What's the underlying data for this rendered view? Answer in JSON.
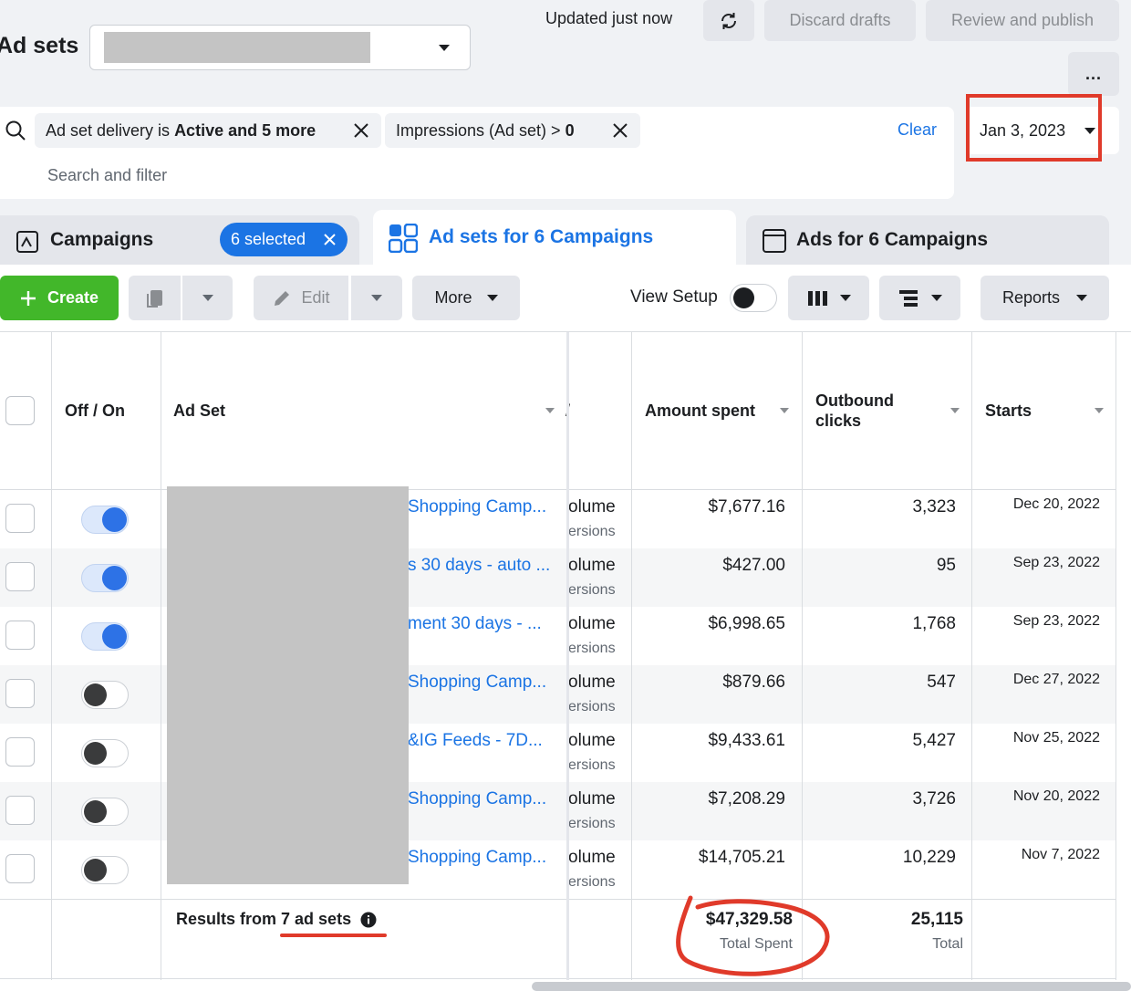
{
  "header": {
    "title": "Ad sets",
    "updated_text": "Updated just now",
    "discard_label": "Discard drafts",
    "review_label": "Review and publish",
    "more_label": "..."
  },
  "filters": {
    "chip1_prefix": "Ad set delivery is ",
    "chip1_bold": "Active and 5 more",
    "chip2_prefix": "Impressions (Ad set) > ",
    "chip2_bold": "0",
    "clear_label": "Clear",
    "search_placeholder": "Search and filter",
    "date": "Jan 3, 2023"
  },
  "tabs": {
    "campaigns": "Campaigns",
    "selected": "6 selected",
    "adsets": "Ad sets for 6 Campaigns",
    "ads": "Ads for 6 Campaigns"
  },
  "toolbar": {
    "create_label": "Create",
    "edit_label": "Edit",
    "more_label": "More",
    "view_setup_label": "View Setup",
    "reports_label": "Reports"
  },
  "table": {
    "headers": {
      "offon": "Off / On",
      "adset": "Ad Set",
      "amount": "Amount spent",
      "clicks_line1": "Outbound",
      "clicks_line2": "clicks",
      "starts": "Starts"
    },
    "rows": [
      {
        "name": "Shopping Camp...",
        "vol": "olume",
        "sub": "ersions",
        "amount": "$7,677.16",
        "clicks": "3,323",
        "start": "Dec 20, 2022",
        "on": true
      },
      {
        "name": "s 30 days - auto ...",
        "vol": "olume",
        "sub": "ersions",
        "amount": "$427.00",
        "clicks": "95",
        "start": "Sep 23, 2022",
        "on": true
      },
      {
        "name": "ment 30 days - ...",
        "vol": "olume",
        "sub": "ersions",
        "amount": "$6,998.65",
        "clicks": "1,768",
        "start": "Sep 23, 2022",
        "on": true
      },
      {
        "name": "Shopping Camp...",
        "vol": "olume",
        "sub": "ersions",
        "amount": "$879.66",
        "clicks": "547",
        "start": "Dec 27, 2022",
        "on": false
      },
      {
        "name": "&IG Feeds - 7D...",
        "vol": "olume",
        "sub": "ersions",
        "amount": "$9,433.61",
        "clicks": "5,427",
        "start": "Nov 25, 2022",
        "on": false
      },
      {
        "name": "Shopping Camp...",
        "vol": "olume",
        "sub": "ersions",
        "amount": "$7,208.29",
        "clicks": "3,726",
        "start": "Nov 20, 2022",
        "on": false
      },
      {
        "name": "Shopping Camp...",
        "vol": "olume",
        "sub": "ersions",
        "amount": "$14,705.21",
        "clicks": "10,229",
        "start": "Nov 7, 2022",
        "on": false
      }
    ],
    "footer": {
      "results_prefix": "Results from ",
      "results_count": "7 ad sets",
      "total_spent": "$47,329.58",
      "total_spent_label": "Total Spent",
      "total_clicks": "25,115",
      "total_clicks_label": "Total"
    }
  },
  "colors": {
    "accent": "#1b74e4",
    "create_green": "#42b72a",
    "annotation_red": "#e03a2a"
  }
}
